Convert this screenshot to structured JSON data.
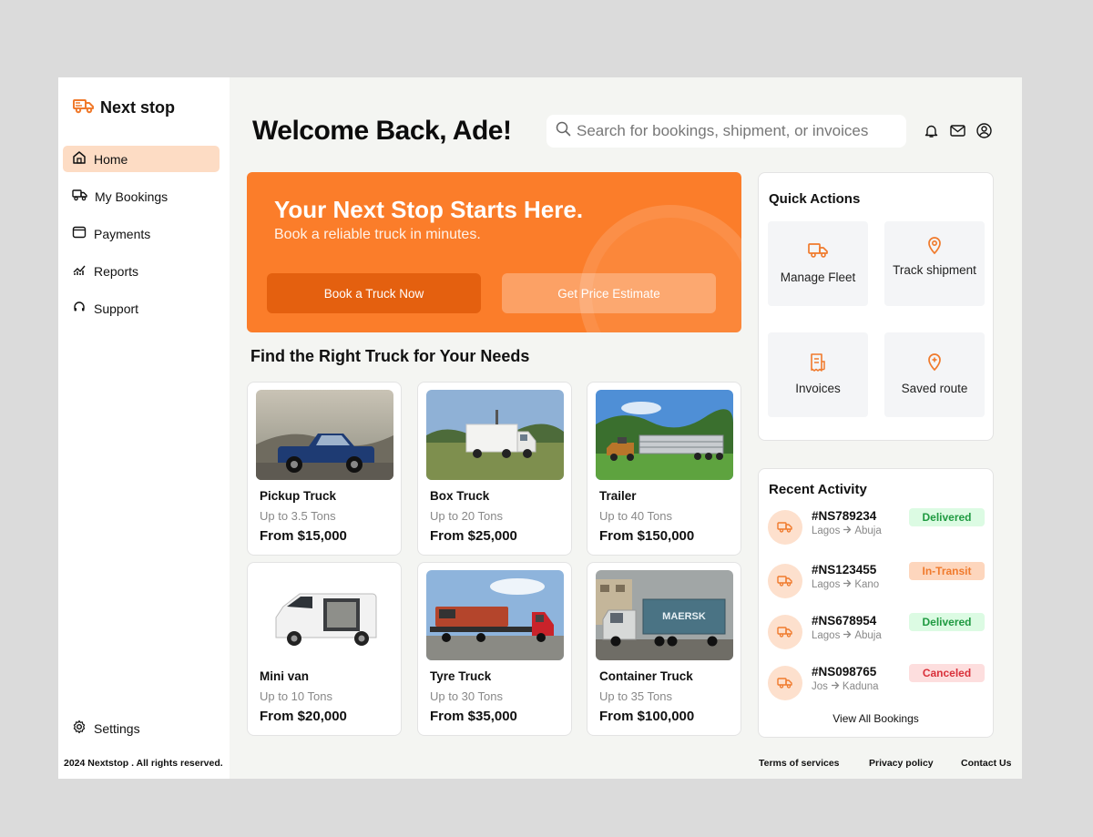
{
  "brand": {
    "name": "Next stop"
  },
  "nav": {
    "items": [
      {
        "label": "Home",
        "icon": "home-icon"
      },
      {
        "label": "My Bookings",
        "icon": "truck-icon"
      },
      {
        "label": "Payments",
        "icon": "wallet-icon"
      },
      {
        "label": "Reports",
        "icon": "chart-icon"
      },
      {
        "label": "Support",
        "icon": "headset-icon"
      }
    ],
    "active": "Home",
    "settings_label": "Settings"
  },
  "footer": {
    "copyright": "2024 Nextstop . All rights reserved.",
    "links": [
      "Terms of services",
      "Privacy policy",
      "Contact Us"
    ]
  },
  "header": {
    "welcome": "Welcome Back, Ade!",
    "search_placeholder": "Search for bookings, shipment, or invoices"
  },
  "hero": {
    "title": "Your Next Stop Starts Here.",
    "subtitle": "Book a reliable truck in minutes.",
    "primary_button": "Book a Truck Now",
    "secondary_button": "Get Price Estimate"
  },
  "trucks": {
    "section_title": "Find the Right Truck for Your Needs",
    "items": [
      {
        "name": "Pickup Truck",
        "capacity": "Up to 3.5 Tons",
        "price": "From $15,000"
      },
      {
        "name": "Box Truck",
        "capacity": "Up to 20 Tons",
        "price": "From $25,000"
      },
      {
        "name": "Trailer",
        "capacity": "Up to 40 Tons",
        "price": "From $150,000"
      },
      {
        "name": "Mini van",
        "capacity": "Up to 10 Tons",
        "price": "From $20,000"
      },
      {
        "name": "Tyre Truck",
        "capacity": "Up to 30 Tons",
        "price": "From $35,000"
      },
      {
        "name": "Container Truck",
        "capacity": "Up to 35 Tons",
        "price": "From $100,000"
      }
    ],
    "container_brand": "MAERSK"
  },
  "quick_actions": {
    "title": "Quick Actions",
    "items": [
      {
        "label": "Manage Fleet",
        "icon": "truck-icon"
      },
      {
        "label": "Track shipment",
        "icon": "location-pin-icon"
      },
      {
        "label": "Invoices",
        "icon": "invoice-icon"
      },
      {
        "label": "Saved route",
        "icon": "add-location-icon"
      }
    ]
  },
  "recent_activity": {
    "title": "Recent Activity",
    "items": [
      {
        "id": "#NS789234",
        "from": "Lagos",
        "to": "Abuja",
        "status": "Delivered",
        "status_type": "delivered"
      },
      {
        "id": "#NS123455",
        "from": "Lagos",
        "to": "Kano",
        "status": "In-Transit",
        "status_type": "transit"
      },
      {
        "id": "#NS678954",
        "from": "Lagos",
        "to": "Abuja",
        "status": "Delivered",
        "status_type": "delivered"
      },
      {
        "id": "#NS098765",
        "from": "Jos",
        "to": "Kaduna",
        "status": "Canceled",
        "status_type": "canceled"
      }
    ],
    "view_all": "View All Bookings"
  },
  "colors": {
    "accent": "#fb7d2a",
    "accent_dark": "#e4600f",
    "active_nav": "#fddcc4",
    "delivered": "#1f9a41",
    "transit": "#f07a2c",
    "canceled": "#d9303a"
  }
}
